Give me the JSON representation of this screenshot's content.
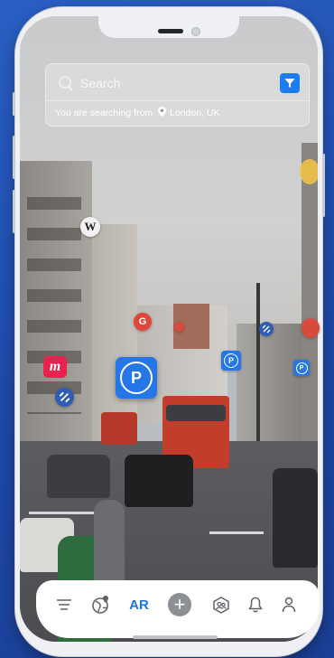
{
  "search": {
    "placeholder": "Search",
    "location_prefix": "You are searching from",
    "location": "London, UK"
  },
  "map_markers": [
    {
      "name": "wikipedia-marker",
      "glyph": "W"
    },
    {
      "name": "google-marker",
      "glyph": "G"
    },
    {
      "name": "meetup-marker",
      "glyph": "m"
    }
  ],
  "parking": {
    "glyph": "P"
  },
  "nav": {
    "ar_label": "AR",
    "add_glyph": "+"
  },
  "colors": {
    "accent": "#1e73e8",
    "parking": "#2577e8",
    "google": "#e0453a",
    "meetup": "#e8214f"
  }
}
